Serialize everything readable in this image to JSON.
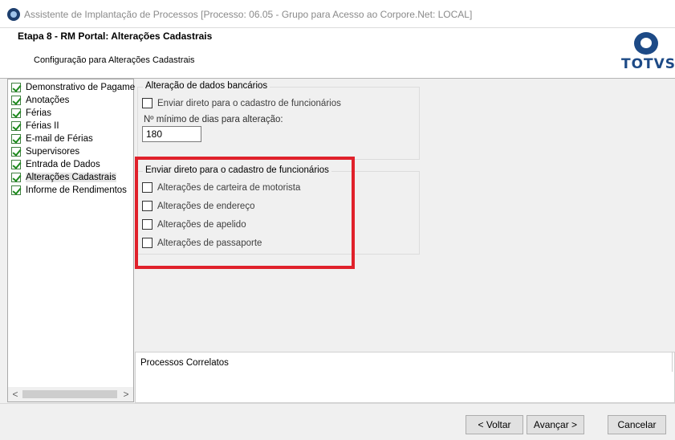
{
  "window": {
    "title": "Assistente de Implantação de Processos [Processo: 06.05 - Grupo para Acesso ao Corpore.Net: LOCAL]"
  },
  "header": {
    "step_title": "Etapa 8 - RM Portal: Alterações Cadastrais",
    "subtitle": "Configuração para Alterações Cadastrais",
    "logo_text": "TOTVS"
  },
  "sidebar": {
    "items": [
      {
        "label": "Demonstrativo de Pagamento",
        "checked": true
      },
      {
        "label": "Anotações",
        "checked": true
      },
      {
        "label": "Férias",
        "checked": true
      },
      {
        "label": "Férias II",
        "checked": true
      },
      {
        "label": "E-mail de Férias",
        "checked": true
      },
      {
        "label": "Supervisores",
        "checked": true
      },
      {
        "label": "Entrada de Dados",
        "checked": true
      },
      {
        "label": "Alterações Cadastrais",
        "checked": true,
        "selected": true
      },
      {
        "label": "Informe de Rendimentos",
        "checked": true
      }
    ],
    "scroll_left": "<",
    "scroll_right": ">"
  },
  "bank_group": {
    "legend": "Alteração de dados bancários",
    "direct_checkbox": {
      "label": "Enviar direto para o cadastro de funcionários",
      "checked": false
    },
    "min_days_label": "Nº mínimo de dias para alteração:",
    "min_days_value": "180"
  },
  "direct_group": {
    "legend": "Enviar direto para o cadastro de funcionários",
    "options": [
      {
        "label": "Alterações de carteira de motorista",
        "checked": false
      },
      {
        "label": "Alterações de endereço",
        "checked": false
      },
      {
        "label": "Alterações de apelido",
        "checked": false
      },
      {
        "label": "Alterações de passaporte",
        "checked": false
      }
    ]
  },
  "related": {
    "title": "Processos Correlatos"
  },
  "buttons": {
    "back": "< Voltar",
    "next": "Avançar >",
    "cancel": "Cancelar"
  },
  "colors": {
    "highlight": "#e0212b",
    "brand": "#1d4a86"
  }
}
